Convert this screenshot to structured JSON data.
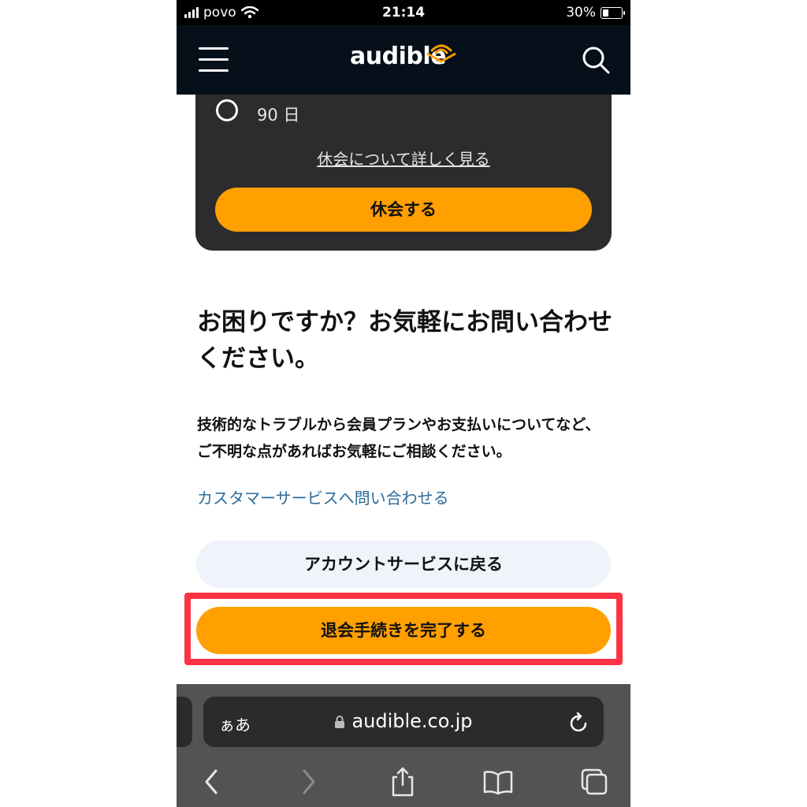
{
  "status_bar": {
    "carrier": "povo",
    "time": "21:14",
    "battery": "30%"
  },
  "header": {
    "logo_text": "audible",
    "menu_icon": "hamburger-icon",
    "search_icon": "search-icon"
  },
  "pause_card": {
    "option_label": "90 日",
    "learn_more_link": "休会について詳しく見る",
    "pause_button": "休会する"
  },
  "help": {
    "title": "お困りですか？お気軽にお問い合わせください。",
    "body": "技術的なトラブルから会員プランやお支払いについてなど、ご不明な点があればお気軽にご相談ください。",
    "contact_link": "カスタマーサービスへ問い合わせる"
  },
  "actions": {
    "back_button": "アカウントサービスに戻る",
    "complete_cancel_button": "退会手続きを完了する"
  },
  "browser": {
    "text_size_label": "ぁあ",
    "url": "audible.co.jp"
  },
  "colors": {
    "accent": "#ff9f00",
    "highlight": "#ff3344",
    "link": "#2d6b99",
    "header_bg": "#06101a"
  }
}
